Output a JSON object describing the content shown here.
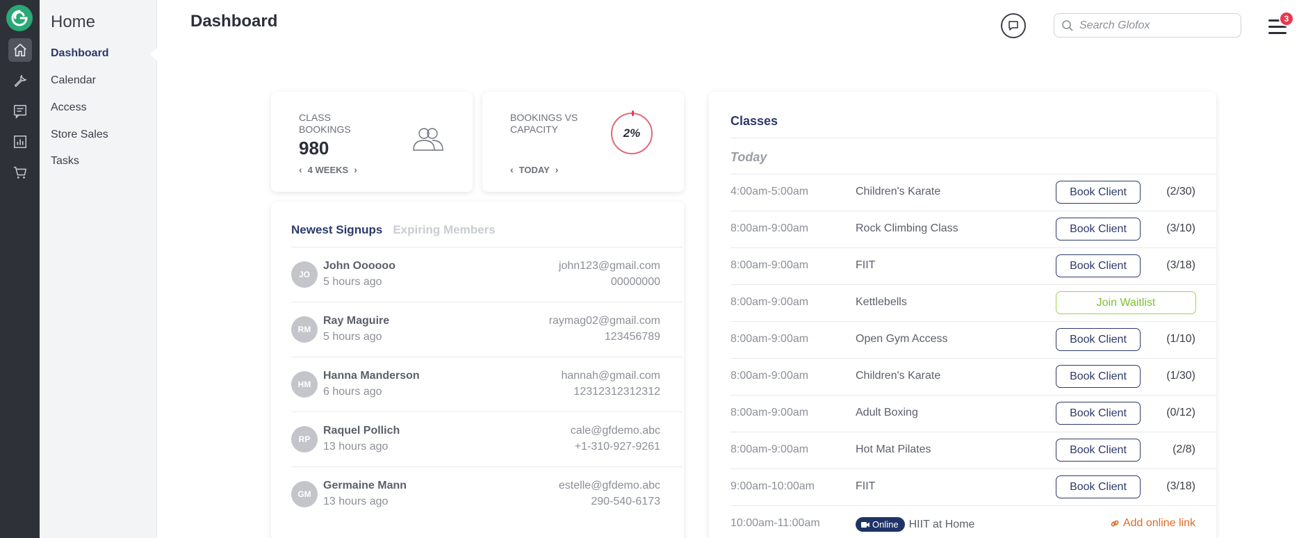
{
  "colors": {
    "rail_bg": "#2e3138",
    "brand_green": "#2aa876",
    "primary_navy": "#2c3a6b",
    "badge_red": "#e8384f",
    "waitlist_green": "#7cbf2e",
    "link_orange": "#e06a28"
  },
  "rail": {
    "icons": [
      "logo-icon",
      "home-icon",
      "wrench-icon",
      "message-icon",
      "bar-chart-icon",
      "cart-icon"
    ]
  },
  "subnav": {
    "title": "Home",
    "items": [
      {
        "label": "Dashboard",
        "active": true
      },
      {
        "label": "Calendar"
      },
      {
        "label": "Access"
      },
      {
        "label": "Store Sales"
      },
      {
        "label": "Tasks"
      }
    ]
  },
  "header": {
    "title": "Dashboard",
    "search_placeholder": "Search Glofox",
    "notification_count": "3"
  },
  "stats": {
    "class_bookings": {
      "label": "CLASS BOOKINGS",
      "value": "980",
      "period": "4 WEEKS"
    },
    "capacity": {
      "label": "BOOKINGS VS CAPACITY",
      "value": "2%",
      "percent": 2,
      "period": "TODAY"
    }
  },
  "signups": {
    "tabs": [
      "Newest Signups",
      "Expiring Members"
    ],
    "rows": [
      {
        "initials": "JO",
        "name": "John Oooooo",
        "time": "5 hours ago",
        "email": "john123@gmail.com",
        "phone": "00000000"
      },
      {
        "initials": "RM",
        "name": "Ray Maguire",
        "time": "5 hours ago",
        "email": "raymag02@gmail.com",
        "phone": "123456789"
      },
      {
        "initials": "HM",
        "name": "Hanna Manderson",
        "time": "6 hours ago",
        "email": "hannah@gmail.com",
        "phone": "12312312312312"
      },
      {
        "initials": "RP",
        "name": "Raquel Pollich",
        "time": "13 hours ago",
        "email": "cale@gfdemo.abc",
        "phone": "+1-310-927-9261"
      },
      {
        "initials": "GM",
        "name": "Germaine Mann",
        "time": "13 hours ago",
        "email": "estelle@gfdemo.abc",
        "phone": "290-540-6173"
      }
    ]
  },
  "classes": {
    "title": "Classes",
    "day_label": "Today",
    "book_label": "Book Client",
    "waitlist_label": "Join Waitlist",
    "online_label": "Online",
    "add_link_label": "Add online link",
    "rows": [
      {
        "time": "4:00am-5:00am",
        "name": "Children's Karate",
        "action": "book",
        "capacity": "(2/30)"
      },
      {
        "time": "8:00am-9:00am",
        "name": "Rock Climbing Class",
        "action": "book",
        "capacity": "(3/10)"
      },
      {
        "time": "8:00am-9:00am",
        "name": "FIIT",
        "action": "book",
        "capacity": "(3/18)"
      },
      {
        "time": "8:00am-9:00am",
        "name": "Kettlebells",
        "action": "waitlist",
        "capacity": ""
      },
      {
        "time": "8:00am-9:00am",
        "name": "Open Gym Access",
        "action": "book",
        "capacity": "(1/10)"
      },
      {
        "time": "8:00am-9:00am",
        "name": "Children's Karate",
        "action": "book",
        "capacity": "(1/30)"
      },
      {
        "time": "8:00am-9:00am",
        "name": "Adult Boxing",
        "action": "book",
        "capacity": "(0/12)"
      },
      {
        "time": "8:00am-9:00am",
        "name": "Hot Mat Pilates",
        "action": "book",
        "capacity": "(2/8)"
      },
      {
        "time": "9:00am-10:00am",
        "name": "FIIT",
        "action": "book",
        "capacity": "(3/18)"
      },
      {
        "time": "10:00am-11:00am",
        "name": "HIIT at Home",
        "action": "online",
        "capacity": ""
      }
    ]
  }
}
